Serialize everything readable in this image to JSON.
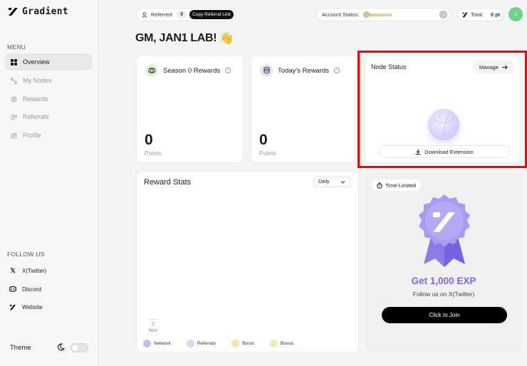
{
  "sidebar": {
    "logo_text": "Gradient",
    "menu_title": "MENU",
    "items": [
      {
        "label": "Overview",
        "icon": "grid-icon",
        "active": true
      },
      {
        "label": "My Nodes",
        "icon": "nodes-icon"
      },
      {
        "label": "Rewards",
        "icon": "rewards-icon"
      },
      {
        "label": "Referrals",
        "icon": "referrals-icon"
      },
      {
        "label": "Profile",
        "icon": "profile-icon"
      }
    ],
    "follow_title": "FOLLOW US",
    "socials": [
      {
        "label": "X(Twitter)",
        "icon": "x-icon"
      },
      {
        "label": "Discord",
        "icon": "discord-icon"
      },
      {
        "label": "Website",
        "icon": "website-icon"
      }
    ],
    "theme_label": "Theme"
  },
  "topbar": {
    "referred_label": "Referred:",
    "referred_count": "0",
    "copy_referral": "Copy Referral Link",
    "account_status_label": "Account Status:",
    "total_label": "Total:",
    "total_value": "0 pt",
    "avatar_initial": "J"
  },
  "greeting": "GM, JAN1 LAB!",
  "greeting_emoji": "👋",
  "season_card": {
    "title": "Season 0 Rewards",
    "value": "0",
    "unit": "Points"
  },
  "today_card": {
    "title": "Today's Rewards",
    "value": "0",
    "unit": "Points"
  },
  "node_status": {
    "title": "Node Status",
    "manage_label": "Manage",
    "download_label": "Download Extension"
  },
  "reward_stats": {
    "title": "Reward Stats",
    "period": "Daily",
    "axis_day": "2",
    "axis_month": "Nov",
    "legend": [
      {
        "label": "Network",
        "color": "#c5bdf2"
      },
      {
        "label": "Referrals",
        "color": "#d9d6f7"
      },
      {
        "label": "Boost",
        "color": "#f0e7a6"
      },
      {
        "label": "Bonus",
        "color": "#e6efb8"
      }
    ]
  },
  "promo": {
    "badge": "Time-Limited",
    "title": "Get 1,000 EXP",
    "subtitle": "Follow us on X(Twitter)",
    "cta": "Click to Join"
  },
  "colors": {
    "accent": "#7b6ae0",
    "highlight": "#ff0000",
    "avatar": "#6ed38a"
  }
}
